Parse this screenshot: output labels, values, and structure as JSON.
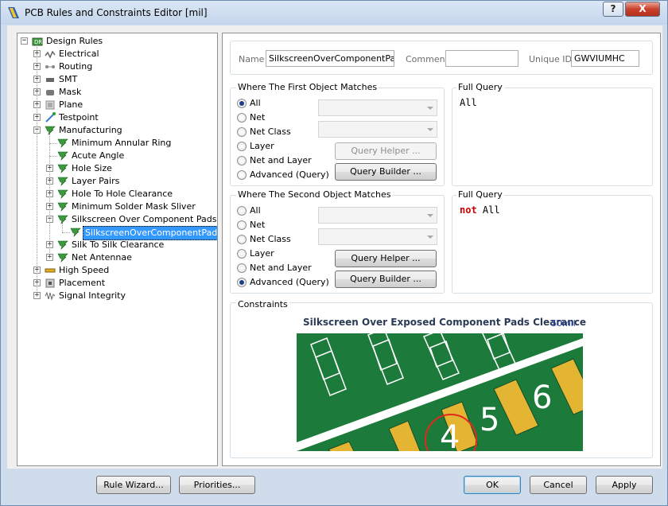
{
  "window": {
    "title": "PCB Rules and Constraints Editor [mil]",
    "help_glyph": "?",
    "close_glyph": "X"
  },
  "tree": {
    "expand_glyph": "+",
    "collapse_glyph": "−",
    "items": [
      {
        "label": "Design Rules",
        "icon": "design-rules-icon",
        "state": "expanded",
        "selected": false
      },
      {
        "label": "Electrical",
        "icon": "electrical-icon",
        "state": "collapsed",
        "selected": false
      },
      {
        "label": "Routing",
        "icon": "routing-icon",
        "state": "collapsed",
        "selected": false
      },
      {
        "label": "SMT",
        "icon": "smt-icon",
        "state": "collapsed",
        "selected": false
      },
      {
        "label": "Mask",
        "icon": "mask-icon",
        "state": "collapsed",
        "selected": false
      },
      {
        "label": "Plane",
        "icon": "plane-icon",
        "state": "collapsed",
        "selected": false
      },
      {
        "label": "Testpoint",
        "icon": "testpoint-icon",
        "state": "collapsed",
        "selected": false
      },
      {
        "label": "Manufacturing",
        "icon": "manufacturing-icon",
        "state": "expanded",
        "selected": false
      },
      {
        "label": "Minimum Annular Ring",
        "icon": "manufacturing-icon",
        "state": "leaf",
        "selected": false
      },
      {
        "label": "Acute Angle",
        "icon": "manufacturing-icon",
        "state": "leaf",
        "selected": false
      },
      {
        "label": "Hole Size",
        "icon": "manufacturing-icon",
        "state": "collapsed",
        "selected": false
      },
      {
        "label": "Layer Pairs",
        "icon": "manufacturing-icon",
        "state": "collapsed",
        "selected": false
      },
      {
        "label": "Hole To Hole Clearance",
        "icon": "manufacturing-icon",
        "state": "collapsed",
        "selected": false
      },
      {
        "label": "Minimum Solder Mask Sliver",
        "icon": "manufacturing-icon",
        "state": "collapsed",
        "selected": false
      },
      {
        "label": "Silkscreen Over Component Pads",
        "icon": "manufacturing-icon",
        "state": "expanded",
        "selected": false
      },
      {
        "label": "SilkscreenOverComponentPads",
        "icon": "manufacturing-icon",
        "state": "leaf",
        "selected": true
      },
      {
        "label": "Silk To Silk Clearance",
        "icon": "manufacturing-icon",
        "state": "collapsed",
        "selected": false
      },
      {
        "label": "Net Antennae",
        "icon": "manufacturing-icon",
        "state": "collapsed",
        "selected": false
      },
      {
        "label": "High Speed",
        "icon": "high-speed-icon",
        "state": "collapsed",
        "selected": false
      },
      {
        "label": "Placement",
        "icon": "placement-icon",
        "state": "collapsed",
        "selected": false
      },
      {
        "label": "Signal Integrity",
        "icon": "signal-integrity-icon",
        "state": "collapsed",
        "selected": false
      }
    ]
  },
  "rule": {
    "name_label": "Name",
    "name_value": "SilkscreenOverComponentPads",
    "comment_label": "Comment",
    "comment_value": "",
    "unique_id_label": "Unique ID",
    "unique_id_value": "GWVIUMHC"
  },
  "first_object": {
    "title": "Where The First Object Matches",
    "options": [
      "All",
      "Net",
      "Net Class",
      "Layer",
      "Net and Layer",
      "Advanced (Query)"
    ],
    "selected_index": 0,
    "query_helper_label": "Query Helper ...",
    "query_builder_label": "Query Builder ...",
    "full_query_title": "Full Query",
    "full_query_keyword": "",
    "full_query_text": "All"
  },
  "second_object": {
    "title": "Where The Second Object Matches",
    "options": [
      "All",
      "Net",
      "Net Class",
      "Layer",
      "Net and Layer",
      "Advanced (Query)"
    ],
    "selected_index": 5,
    "query_helper_label": "Query Helper ...",
    "query_builder_label": "Query Builder ...",
    "full_query_title": "Full Query",
    "full_query_keyword": "not",
    "full_query_text": "All"
  },
  "constraints": {
    "title": "Constraints",
    "heading": "Silkscreen Over Exposed Component Pads Clearance",
    "value": "50mil",
    "pad_numbers": [
      "4",
      "5",
      "6"
    ]
  },
  "colors": {
    "board_green": "#1c7a3a",
    "pad_gold": "#e4b433",
    "silk_white": "#ffffff",
    "highlight_red": "#e02a20",
    "selection_blue": "#3399ff"
  },
  "footer": {
    "rule_wizard_label": "Rule Wizard...",
    "priorities_label": "Priorities...",
    "ok_label": "OK",
    "cancel_label": "Cancel",
    "apply_label": "Apply"
  }
}
